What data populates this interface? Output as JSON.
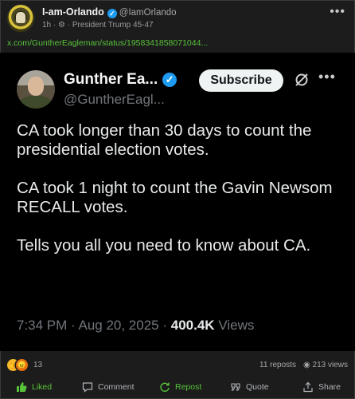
{
  "post": {
    "author": "I-am-Orlando",
    "handle": "@IamOrlando",
    "time": "1h",
    "audience": "President Trump 45-47",
    "link": "x.com/GuntherEagleman/status/1958341858071044..."
  },
  "tweet": {
    "name": "Gunther Ea...",
    "handle": "@GuntherEagl...",
    "subscribe_label": "Subscribe",
    "paragraphs": [
      "CA took longer than 30 days to count the presidential election votes.",
      "CA took 1 night to count the Gavin Newsom RECALL votes.",
      "Tells you all you need to know about CA."
    ],
    "timestamp": "7:34 PM · Aug 20, 2025 ·",
    "views_count": "400.4K",
    "views_label": "Views"
  },
  "stats": {
    "reaction_count": "13",
    "reposts": "11 reposts",
    "views": "213 views"
  },
  "actions": {
    "like": "Liked",
    "comment": "Comment",
    "repost": "Repost",
    "quote": "Quote",
    "share": "Share"
  },
  "colors": {
    "accent_green": "#57c33a",
    "verified_blue": "#1d9bf0"
  }
}
